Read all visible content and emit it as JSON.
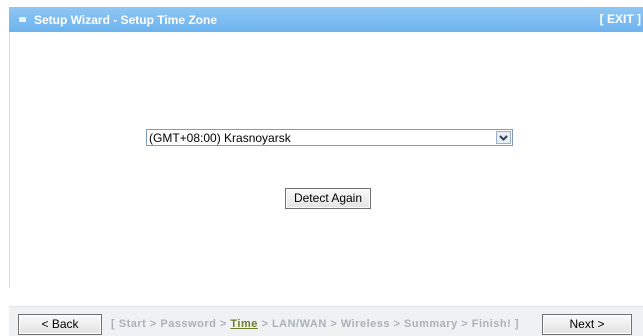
{
  "header": {
    "title": "Setup Wizard - Setup Time Zone",
    "exit_label": "[ EXIT ]"
  },
  "timezone": {
    "selected": "(GMT+08:00) Krasnoyarsk"
  },
  "buttons": {
    "detect_again": "Detect Again",
    "back": "< Back",
    "next": "Next >"
  },
  "steps": {
    "open": "[",
    "items": [
      "Start",
      "Password",
      "Time",
      "LAN/WAN",
      "Wireless",
      "Summary",
      "Finish!"
    ],
    "separator": ">",
    "close": "]",
    "current_index": 2
  },
  "colors": {
    "header_blue": "#7dbdf1",
    "current_step": "#6c7f2b",
    "inactive_step": "#a9b2bb",
    "footer_bg": "#f0f1f2"
  },
  "icons": {
    "header_bullet": "bullet-icon",
    "select_arrow": "chevron-down-icon"
  }
}
